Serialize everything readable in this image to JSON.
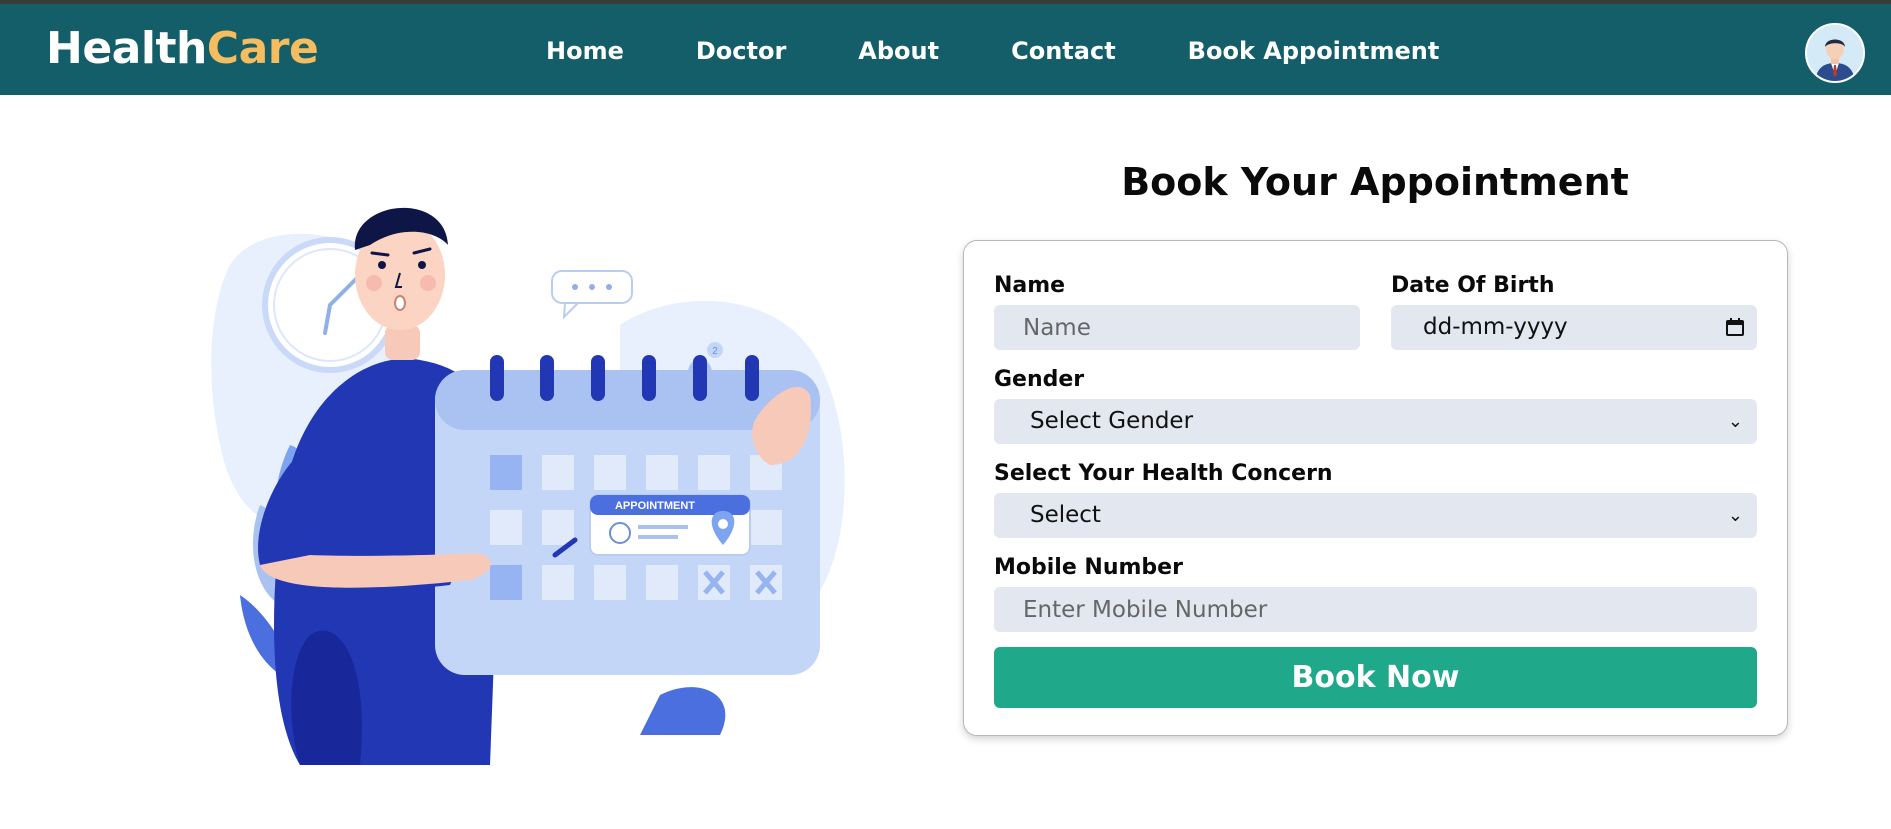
{
  "brand": {
    "part1": "Health",
    "part2": "Care"
  },
  "nav": {
    "items": [
      {
        "label": "Home"
      },
      {
        "label": "Doctor"
      },
      {
        "label": "About"
      },
      {
        "label": "Contact"
      },
      {
        "label": "Book Appointment"
      }
    ]
  },
  "illustration": {
    "badge": "APPOINTMENT",
    "bell_count": "2"
  },
  "form": {
    "title": "Book Your Appointment",
    "name_label": "Name",
    "name_placeholder": "Name",
    "dob_label": "Date Of Birth",
    "dob_value": "dd-mm-yyyy",
    "gender_label": "Gender",
    "gender_selected": "Select Gender",
    "concern_label": "Select Your Health Concern",
    "concern_selected": "Select",
    "mobile_label": "Mobile Number",
    "mobile_placeholder": "Enter Mobile Number",
    "submit_label": "Book Now"
  },
  "colors": {
    "nav_bg": "#135e68",
    "brand_accent": "#f5bd5f",
    "button_bg": "#1fa98a",
    "field_bg": "#e2e7f0"
  },
  "icons": [
    "avatar-icon",
    "calendar-icon",
    "chevron-down-icon"
  ]
}
